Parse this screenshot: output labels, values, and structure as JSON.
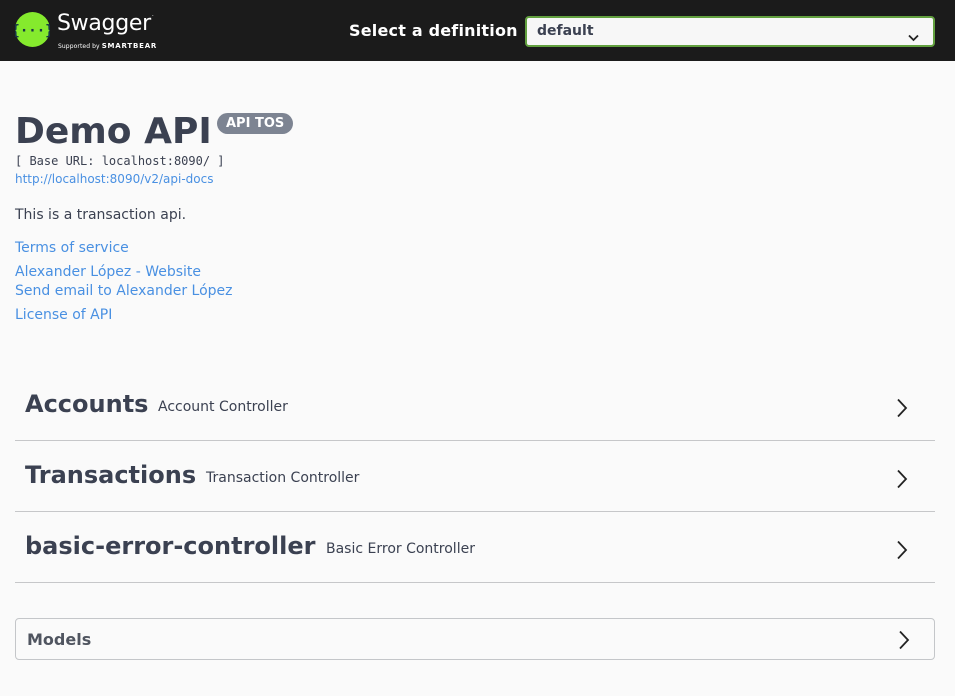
{
  "header": {
    "logo": {
      "icon": "swagger-logo-icon",
      "brand": "Swagger",
      "tagline_prefix": "Supported by",
      "tagline_brand": "SMARTBEAR",
      "color": "#85ea2d"
    },
    "definition_label": "Select a definition",
    "definition_select": {
      "value": "default",
      "icon": "chevron-down-icon"
    }
  },
  "info": {
    "title": "Demo API",
    "version_badge": "API TOS",
    "base_url": "[ Base URL: localhost:8090/ ]",
    "spec_link": "http://localhost:8090/v2/api-docs",
    "description": "This is a transaction api.",
    "terms_link": "Terms of service",
    "contact_website": "Alexander López - Website",
    "contact_email": "Send email to Alexander López",
    "license_link": "License of API"
  },
  "tags": [
    {
      "name": "Accounts",
      "description": "Account Controller",
      "icon": "chevron-right-icon"
    },
    {
      "name": "Transactions",
      "description": "Transaction Controller",
      "icon": "chevron-right-icon"
    },
    {
      "name": "basic-error-controller",
      "description": "Basic Error Controller",
      "icon": "chevron-right-icon"
    }
  ],
  "models": {
    "title": "Models",
    "icon": "chevron-right-icon"
  },
  "colors": {
    "topbar": "#1b1b1b",
    "select_border": "#62a03f",
    "link": "#4990e2",
    "badge": "#7d8492",
    "text": "#3b4151"
  }
}
